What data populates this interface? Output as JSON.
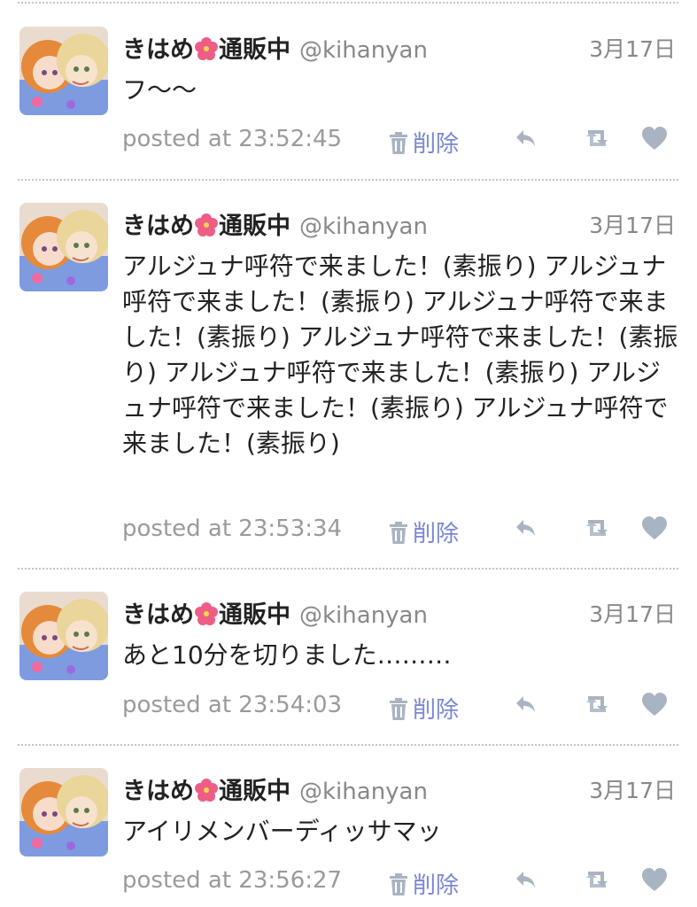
{
  "tweets": [
    {
      "name": "きはめ",
      "name_suffix": "通販中",
      "handle": "@kihanyan",
      "date": "3月17日",
      "text": "フ〜〜",
      "posted": "posted at 23:52:45",
      "delete_label": "削除"
    },
    {
      "name": "きはめ",
      "name_suffix": "通販中",
      "handle": "@kihanyan",
      "date": "3月17日",
      "text": "アルジュナ呼符で来ました！(素振り) アルジュナ呼符で来ました！(素振り) アルジュナ呼符で来ました！(素振り) アルジュナ呼符で来ました！(素振り) アルジュナ呼符で来ました！(素振り) アルジュナ呼符で来ました！(素振り) アルジュナ呼符で来ました！(素振り)",
      "posted": "posted at 23:53:34",
      "delete_label": "削除"
    },
    {
      "name": "きはめ",
      "name_suffix": "通販中",
      "handle": "@kihanyan",
      "date": "3月17日",
      "text": "あと10分を切りました………",
      "posted": "posted at 23:54:03",
      "delete_label": "削除"
    },
    {
      "name": "きはめ",
      "name_suffix": "通販中",
      "handle": "@kihanyan",
      "date": "3月17日",
      "text": "アイリメンバーディッサマッ",
      "posted": "posted at 23:56:27",
      "delete_label": "削除"
    }
  ],
  "icons": {
    "name_emoji": "hibiscus-icon",
    "delete": "trash-icon",
    "reply": "reply-icon",
    "retweet": "retweet-icon",
    "like": "heart-icon"
  },
  "colors": {
    "delete_link": "#7a86d6",
    "action_icons": "#a9b4c2",
    "meta_text": "#9a9a9a"
  }
}
